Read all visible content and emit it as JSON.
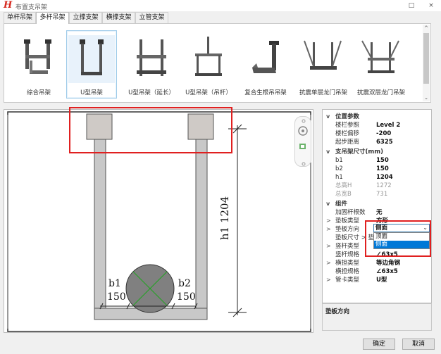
{
  "window": {
    "title": "布置支吊架",
    "logo": "H",
    "minimize": "□",
    "close": "×"
  },
  "tabs": [
    "单杆吊架",
    "多杆吊架",
    "立撑支架",
    "横撑支架",
    "立管支架"
  ],
  "gallery": {
    "items": [
      "综合吊架",
      "U型吊架",
      "U型吊架（延长）",
      "U型吊架（吊杆）",
      "复合生根吊吊架",
      "抗震单层龙门吊架",
      "抗震双层龙门吊架"
    ],
    "selected": "U型吊架",
    "scroll_up": "^",
    "scroll_down": "⌄"
  },
  "drawing": {
    "dim_h1_label": "h1 1204",
    "dim_b1_label": "b1",
    "dim_b1_value": "150",
    "dim_b2_label": "b2",
    "dim_b2_value": "150"
  },
  "properties": {
    "cat_position": "位置参数",
    "label_ref": "楼栏参照",
    "value_ref": "Level 2",
    "label_offset": "楼栏偏移",
    "value_offset": "-200",
    "label_height": "起步距离",
    "value_height": "6325",
    "cat_size": "支吊架尺寸(mm)",
    "label_b1": "b1",
    "value_b1": "150",
    "label_b2": "b2",
    "value_b2": "150",
    "label_h1": "h1",
    "value_h1": "1204",
    "label_total_h": "总高H",
    "value_total_h": "1272",
    "label_total_b": "总宽B",
    "value_total_b": "731",
    "cat_component": "组件",
    "label_rib": "加固杆根数",
    "value_rib": "无",
    "label_pad_type": "垫板类型",
    "value_pad_type": "方形",
    "label_pad_dir": "垫板方向",
    "value_pad_dir": "侧面",
    "label_pad_size": "垫板尺寸 > 垫杆",
    "label_rod_type": "竖杆类型",
    "label_rod_spec": "竖杆规格",
    "value_rod_spec": "∠63x5",
    "label_beam_type": "横担类型",
    "value_beam_type": "等边角钢",
    "label_beam_spec": "横担规格",
    "value_beam_spec": "∠63x5",
    "label_clamp": "管卡类型",
    "value_clamp": "U型",
    "expand": ">",
    "collapse": "v"
  },
  "dropdown": {
    "value": "侧面",
    "arrow": "⌄",
    "options": [
      "顶面",
      "侧面"
    ],
    "selected_index": 1
  },
  "description": {
    "title": "垫板方向"
  },
  "buttons": {
    "ok": "确定",
    "cancel": "取消"
  },
  "colors": {
    "highlight": "#e02020",
    "selection": "#0078d7",
    "steel": "#c8c8c8",
    "pipe": "#808080"
  }
}
